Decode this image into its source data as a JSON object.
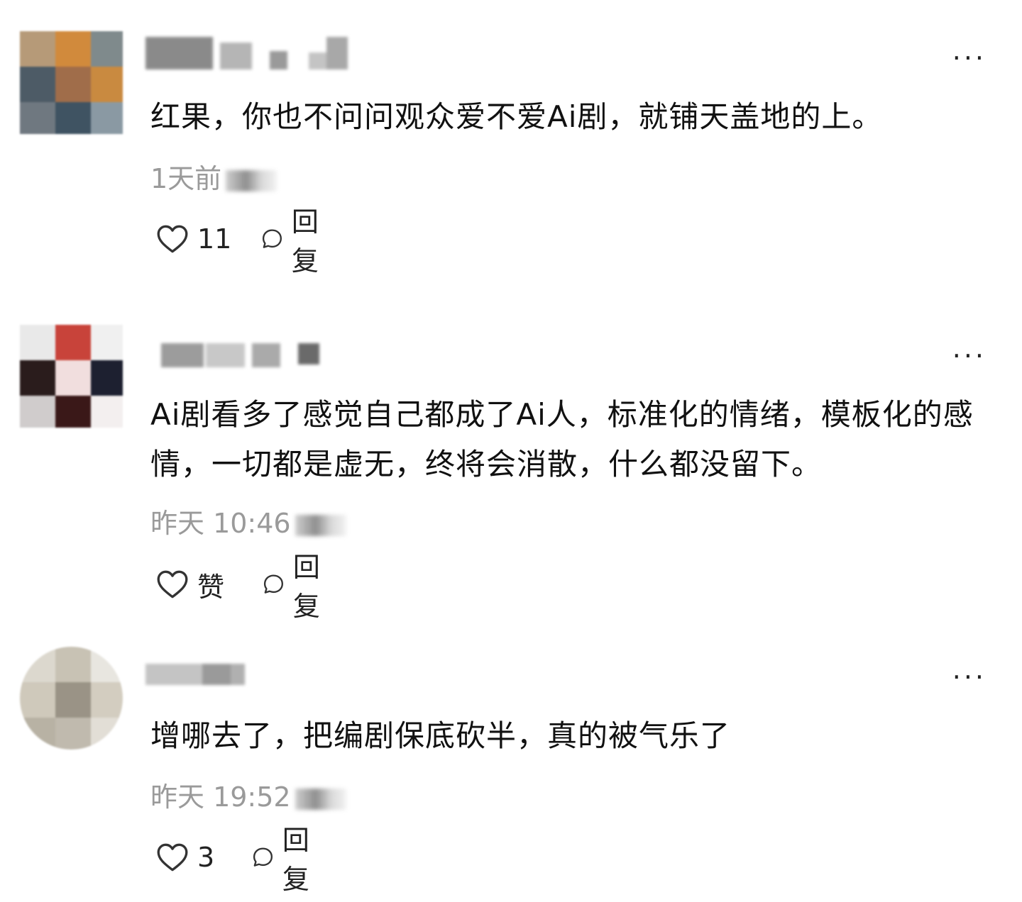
{
  "comments": [
    {
      "text": "红果，你也不问问观众爱不爱Ai剧，就铺天盖地的上。",
      "time": "1天前",
      "like_label": "11",
      "reply_label": "回复",
      "more_label": "···"
    },
    {
      "text": "Ai剧看多了感觉自己都成了Ai人，标准化的情绪，模板化的感情，一切都是虚无，终将会消散，什么都没留下。",
      "time": "昨天 10:46",
      "like_label": "赞",
      "reply_label": "回复",
      "more_label": "···"
    },
    {
      "text": "增哪去了，把编剧保底砍半，真的被气乐了",
      "time": "昨天 19:52",
      "like_label": "3",
      "reply_label": "回复",
      "more_label": "···"
    }
  ]
}
